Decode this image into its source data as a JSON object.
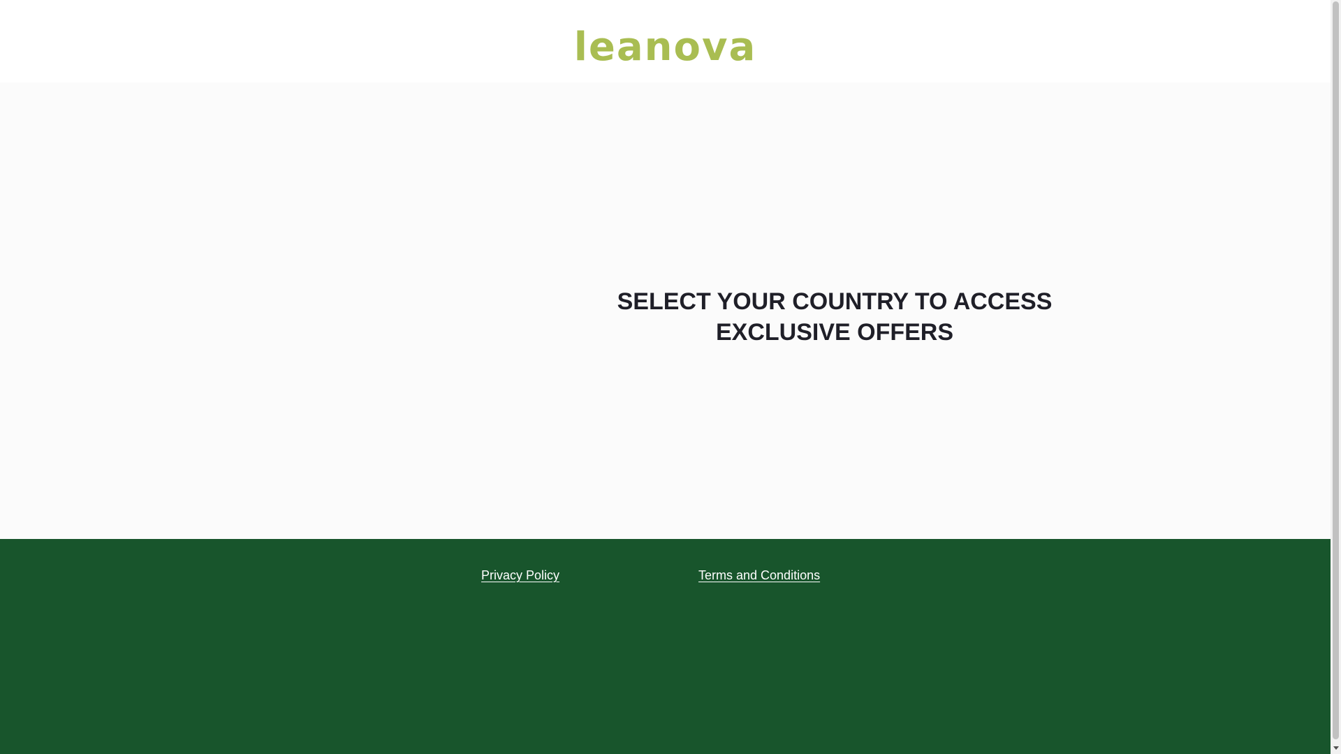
{
  "brand": {
    "logo_text": "leanova",
    "logo_color": "#a9bd52"
  },
  "hero": {
    "headline_line1": "SELECT YOUR COUNTRY TO ACCESS",
    "headline_line2": "EXCLUSIVE OFFERS"
  },
  "footer": {
    "background_color": "#18552c",
    "links": [
      {
        "label": "Privacy Policy"
      },
      {
        "label": "Terms and Conditions"
      }
    ]
  }
}
